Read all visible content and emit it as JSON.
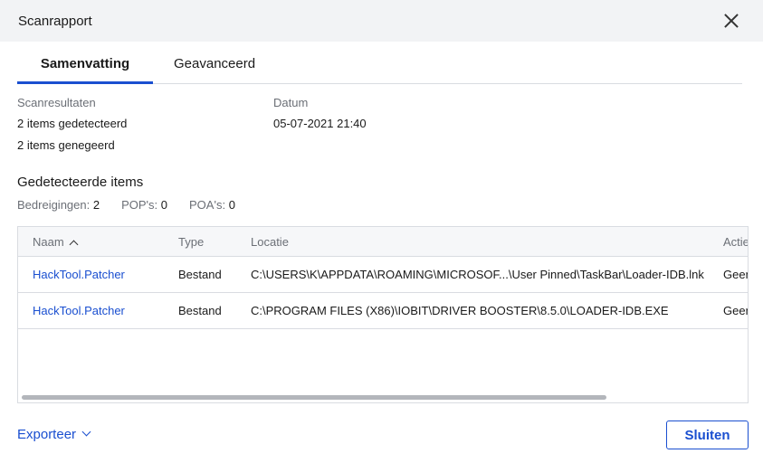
{
  "window": {
    "title": "Scanrapport"
  },
  "tabs": [
    {
      "label": "Samenvatting",
      "active": true
    },
    {
      "label": "Geavanceerd",
      "active": false
    }
  ],
  "summary": {
    "results_label": "Scanresultaten",
    "detected": "2 items gedetecteerd",
    "ignored": "2 items genegeerd",
    "date_label": "Datum",
    "date_value": "05-07-2021 21:40"
  },
  "detected_items": {
    "title": "Gedetecteerde items",
    "counts": [
      {
        "label": "Bedreigingen:",
        "value": "2"
      },
      {
        "label": "POP's:",
        "value": "0"
      },
      {
        "label": "POA's:",
        "value": "0"
      }
    ]
  },
  "table": {
    "columns": [
      "Naam",
      "Type",
      "Locatie",
      "Actie"
    ],
    "sort_column": "Naam",
    "sort_direction": "ascending",
    "rows": [
      {
        "name": "HackTool.Patcher",
        "type": "Bestand",
        "location": "C:\\USERS\\K\\APPDATA\\ROAMING\\MICROSOF...\\User Pinned\\TaskBar\\Loader-IDB.lnk",
        "action": "Geen"
      },
      {
        "name": "HackTool.Patcher",
        "type": "Bestand",
        "location": "C:\\PROGRAM FILES (X86)\\IOBIT\\DRIVER BOOSTER\\8.5.0\\LOADER-IDB.EXE",
        "action": "Geen"
      }
    ]
  },
  "footer": {
    "export_label": "Exporteer",
    "close_label": "Sluiten"
  },
  "colors": {
    "accent": "#1a4fd0",
    "titlebar": "#f2f3f5",
    "muted_text": "#6b6f76",
    "border": "#d9dce1"
  },
  "icons": {
    "close": "close-icon",
    "sort": "sort-ascending-icon",
    "export_dropdown": "chevron-down-icon"
  }
}
